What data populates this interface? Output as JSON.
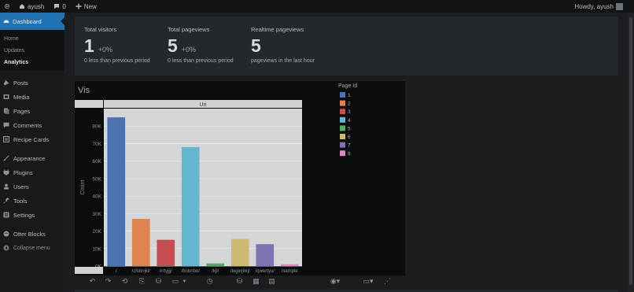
{
  "adminbar": {
    "site_name": "ayush",
    "comments_count": "0",
    "new_label": "New",
    "greeting": "Howdy, ayush"
  },
  "sidebar": {
    "dashboard": "Dashboard",
    "sub_items": [
      "Home",
      "Updates",
      "Analytics"
    ],
    "items": [
      {
        "label": "Posts",
        "icon": "pin-icon"
      },
      {
        "label": "Media",
        "icon": "media-icon"
      },
      {
        "label": "Pages",
        "icon": "pages-icon"
      },
      {
        "label": "Comments",
        "icon": "comment-icon"
      },
      {
        "label": "Recipe Cards",
        "icon": "recipe-icon"
      },
      {
        "label": "Appearance",
        "icon": "brush-icon"
      },
      {
        "label": "Plugins",
        "icon": "plugin-icon"
      },
      {
        "label": "Users",
        "icon": "users-icon"
      },
      {
        "label": "Tools",
        "icon": "wrench-icon"
      },
      {
        "label": "Settings",
        "icon": "settings-icon"
      },
      {
        "label": "Otter Blocks",
        "icon": "otter-icon"
      }
    ],
    "collapse": "Collapse menu"
  },
  "stats": [
    {
      "label": "Total visitors",
      "value": "1",
      "delta": "+0%",
      "note": "0 less than previous period"
    },
    {
      "label": "Total pageviews",
      "value": "5",
      "delta": "+0%",
      "note": "0 less than previous period"
    },
    {
      "label": "Realtime pageviews",
      "value": "5",
      "delta": "",
      "note": "pageviews in the last hour"
    }
  ],
  "vis": {
    "title": "Vis"
  },
  "chart_data": {
    "type": "bar",
    "title": "Uri",
    "xlabel": "",
    "ylabel": "Count",
    "categories": [
      "/",
      "/cfvbnjkl/",
      "/rrtyjjj/",
      "/bnbnbn/",
      "/kjl/",
      "/loginjkkj/",
      "/qwertyu/",
      "/sample"
    ],
    "values": [
      85000,
      27000,
      15000,
      68000,
      1500,
      15500,
      12500,
      1000
    ],
    "ylim": [
      0,
      90000
    ],
    "yticks": [
      0,
      10000,
      20000,
      30000,
      40000,
      50000,
      60000,
      70000,
      80000
    ],
    "ytick_labels": [
      "0K",
      "10K",
      "20K",
      "30K",
      "40K",
      "50K",
      "60K",
      "70K",
      "80K"
    ],
    "grid": true,
    "legend_title": "Page Id",
    "legend_placement": "right",
    "legend": [
      "1",
      "2",
      "3",
      "4",
      "5",
      "6",
      "7",
      "8"
    ],
    "colors": [
      "#4c72b0",
      "#dd8452",
      "#c44e52",
      "#64b5cd",
      "#55a868",
      "#ccb974",
      "#8172b3",
      "#da8bc3"
    ]
  }
}
